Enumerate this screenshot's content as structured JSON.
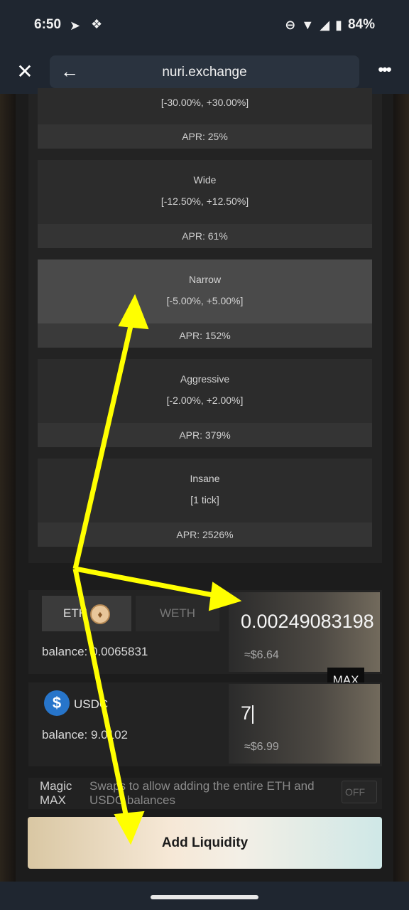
{
  "status_bar": {
    "time": "6:50",
    "battery": "84%"
  },
  "browser": {
    "url": "nuri.exchange"
  },
  "ranges": [
    {
      "name": "",
      "range": "[-30.00%, +30.00%]",
      "apr": "APR: 25%"
    },
    {
      "name": "Wide",
      "range": "[-12.50%, +12.50%]",
      "apr": "APR: 61%"
    },
    {
      "name": "Narrow",
      "range": "[-5.00%, +5.00%]",
      "apr": "APR: 152%",
      "selected": true
    },
    {
      "name": "Aggressive",
      "range": "[-2.00%, +2.00%]",
      "apr": "APR: 379%"
    },
    {
      "name": "Insane",
      "range": "[1 tick]",
      "apr": "APR: 2526%"
    }
  ],
  "token_a": {
    "toggle": [
      "ETH",
      "WETH"
    ],
    "balance": "balance: 0.0065831",
    "amount": "0.00249083198",
    "usd": "≈$6.64",
    "max_label": "MAX"
  },
  "token_b": {
    "symbol": "USDC",
    "balance": "balance: 9.0102",
    "amount": "7",
    "usd": "≈$6.99"
  },
  "magic_max": {
    "label": "Magic MAX",
    "description": "Swaps to allow adding the entire ETH and USDC balances",
    "state": "OFF"
  },
  "add_button": "Add Liquidity",
  "colors": {
    "annotation_arrow": "#ffff00",
    "usdc": "#2775ca",
    "selected_card": "#4a4a4a"
  }
}
